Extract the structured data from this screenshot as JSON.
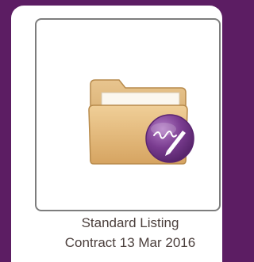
{
  "document_tile": {
    "title_line1": "Standard Listing",
    "title_line2": "Contract 13 Mar 2016",
    "icon": "folder-with-signature-icon"
  },
  "colors": {
    "background": "#5c1d63",
    "folder": "#d9ab6b",
    "badge": "#7a3c90",
    "caption_text": "#4b3f3c"
  }
}
